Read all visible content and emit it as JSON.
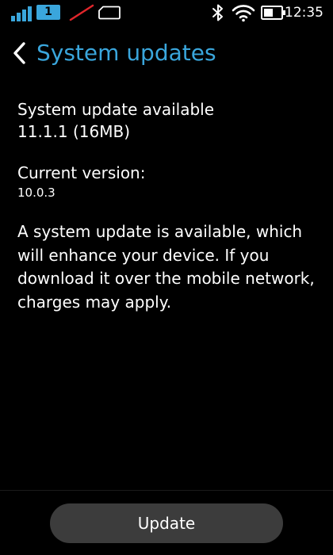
{
  "status_bar": {
    "sim_slot": "1",
    "time": "12:35",
    "icons": {
      "signal": "signal-strength-icon",
      "no_sim": "no-sim-icon",
      "sim_card": "sim-card-icon",
      "bluetooth": "bluetooth-icon",
      "wifi": "wifi-icon",
      "battery": "battery-icon"
    }
  },
  "header": {
    "back_icon": "chevron-left-icon",
    "title": "System updates"
  },
  "update_info": {
    "available_label": "System update available",
    "available_version": "11.1.1 (16MB)",
    "current_label": "Current version:",
    "current_version": "10.0.3",
    "description": "A system update is available, which will enhance your device. If you download it over the mobile network, charges may apply."
  },
  "actions": {
    "update_label": "Update"
  },
  "colors": {
    "accent": "#3aa6dc",
    "background": "#000000",
    "button": "#3c3c3c",
    "no_sim_slash": "#e0262b"
  }
}
